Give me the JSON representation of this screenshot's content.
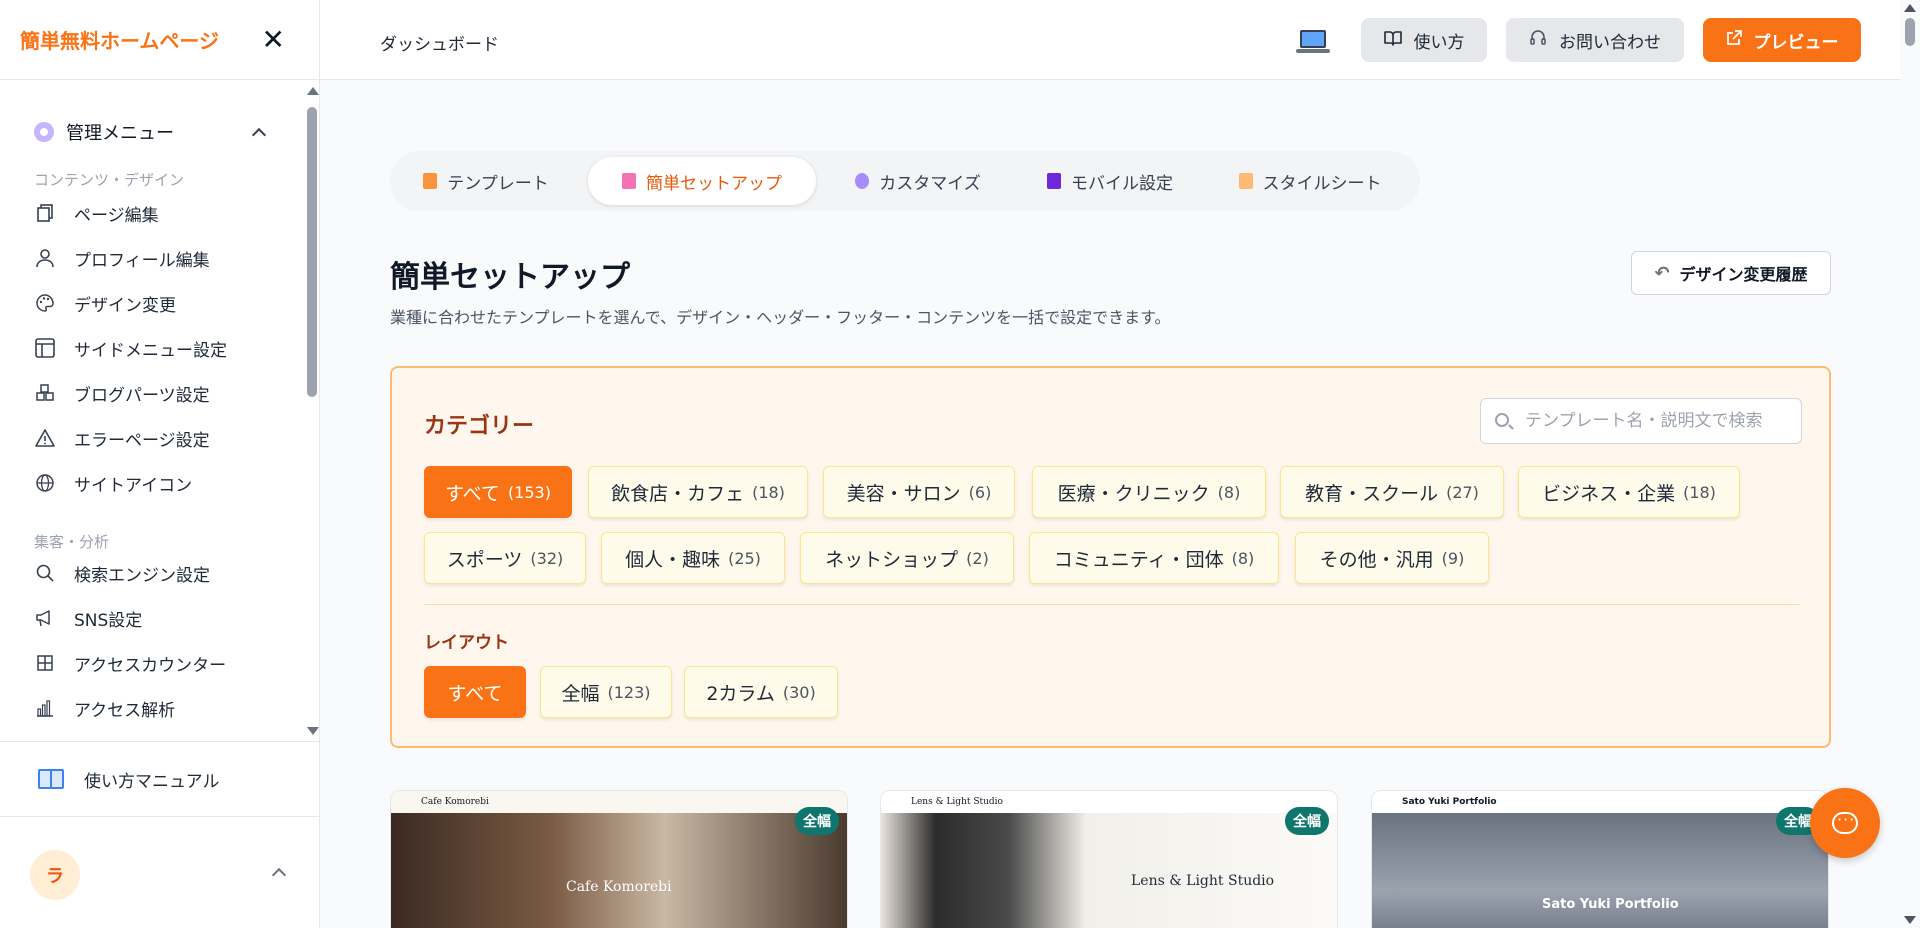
{
  "sidebar": {
    "logo": "簡単無料ホームページ",
    "management_menu": "管理メニュー",
    "section_content_design": "コンテンツ・デザイン",
    "section_marketing": "集客・分析",
    "items": [
      {
        "label": "ページ編集",
        "icon": "pages-icon"
      },
      {
        "label": "プロフィール編集",
        "icon": "user-icon"
      },
      {
        "label": "デザイン変更",
        "icon": "palette-icon"
      },
      {
        "label": "サイドメニュー設定",
        "icon": "layout-icon"
      },
      {
        "label": "ブログパーツ設定",
        "icon": "blocks-icon"
      },
      {
        "label": "エラーページ設定",
        "icon": "warning-icon"
      },
      {
        "label": "サイトアイコン",
        "icon": "globe-icon"
      },
      {
        "label": "検索エンジン設定",
        "icon": "search-icon"
      },
      {
        "label": "SNS設定",
        "icon": "megaphone-icon"
      },
      {
        "label": "アクセスカウンター",
        "icon": "grid-icon"
      },
      {
        "label": "アクセス解析",
        "icon": "bar-chart-icon"
      }
    ],
    "manual": "使い方マニュアル",
    "avatar_initial": "ラ"
  },
  "header": {
    "breadcrumb": "ダッシュボード",
    "howto": "使い方",
    "contact": "お問い合わせ",
    "preview": "プレビュー"
  },
  "tabs": [
    {
      "label": "テンプレート",
      "color": "#fb923c"
    },
    {
      "label": "簡単セットアップ",
      "color": "#f472b6"
    },
    {
      "label": "カスタマイズ",
      "color": "#a78bfa"
    },
    {
      "label": "モバイル設定",
      "color": "#6d28d9"
    },
    {
      "label": "スタイルシート",
      "color": "#fdba74"
    }
  ],
  "main": {
    "title": "簡単セットアップ",
    "description": "業種に合わせたテンプレートを選んで、デザイン・ヘッダー・フッター・コンテンツを一括で設定できます。",
    "history_button": "デザイン変更履歴"
  },
  "category": {
    "title": "カテゴリー",
    "search_placeholder": "テンプレート名・説明文で検索",
    "chips": [
      {
        "label": "すべて",
        "count": "(153)"
      },
      {
        "label": "飲食店・カフェ",
        "count": "(18)"
      },
      {
        "label": "美容・サロン",
        "count": "(6)"
      },
      {
        "label": "医療・クリニック",
        "count": "(8)"
      },
      {
        "label": "教育・スクール",
        "count": "(27)"
      },
      {
        "label": "ビジネス・企業",
        "count": "(18)"
      },
      {
        "label": "スポーツ",
        "count": "(32)"
      },
      {
        "label": "個人・趣味",
        "count": "(25)"
      },
      {
        "label": "ネットショップ",
        "count": "(2)"
      },
      {
        "label": "コミュニティ・団体",
        "count": "(8)"
      },
      {
        "label": "その他・汎用",
        "count": "(9)"
      }
    ],
    "layout_title": "レイアウト",
    "layout_chips": [
      {
        "label": "すべて",
        "count": ""
      },
      {
        "label": "全幅",
        "count": "(123)"
      },
      {
        "label": "2カラム",
        "count": "(30)"
      }
    ]
  },
  "cards": [
    {
      "header": "Cafe Komorebi",
      "title": "Cafe Komorebi",
      "badge": "全幅"
    },
    {
      "header": "Lens & Light Studio",
      "title": "Lens & Light Studio",
      "badge": "全幅"
    },
    {
      "header": "Sato Yuki Portfolio",
      "title": "Sato Yuki Portfolio",
      "badge": "全幅"
    }
  ],
  "colors": {
    "accent": "#f97316",
    "badge": "#0f766e"
  }
}
